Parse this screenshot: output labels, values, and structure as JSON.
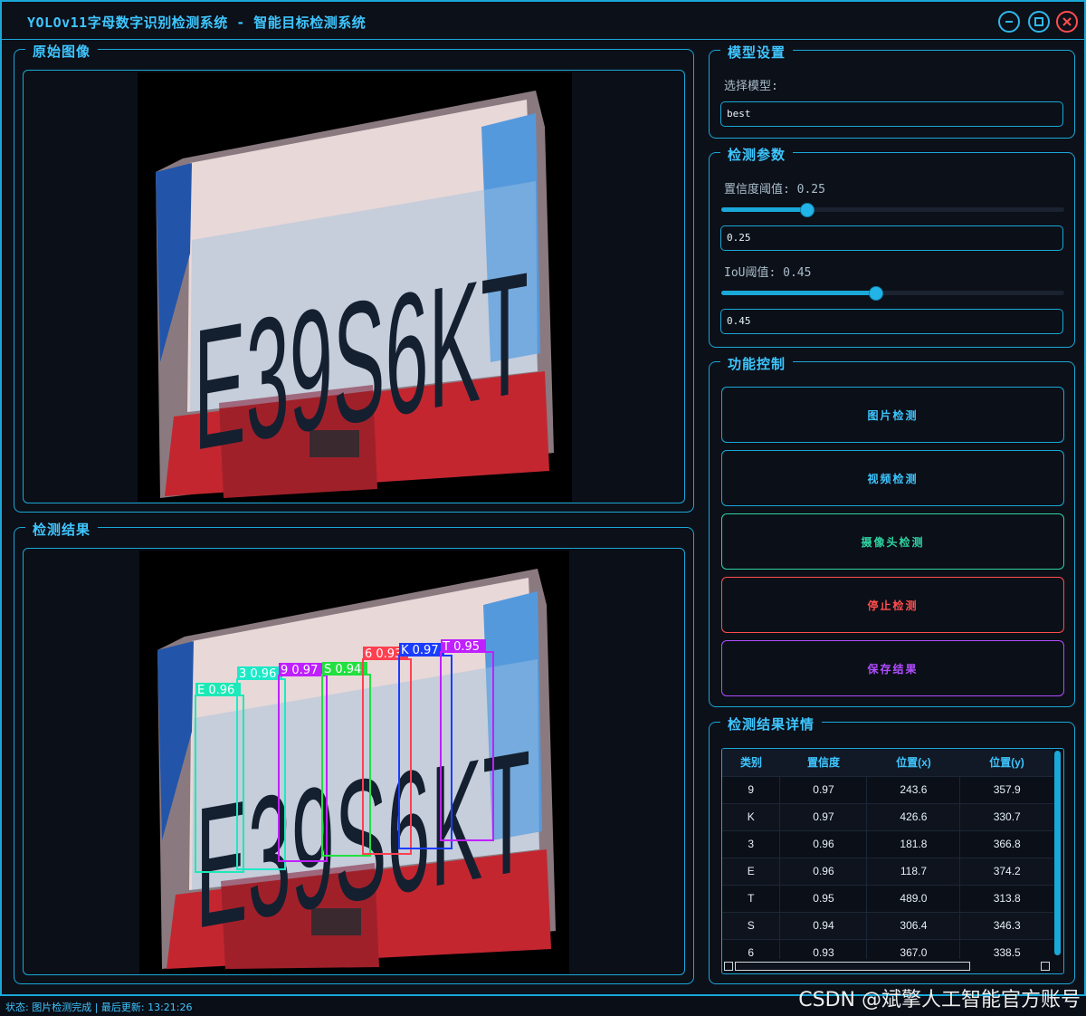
{
  "window": {
    "title": "YOLOv11字母数字识别检测系统 - 智能目标检测系统",
    "min_icon": "minimize-icon",
    "max_icon": "maximize-icon",
    "close_icon": "close-icon"
  },
  "original_panel": {
    "title": "原始图像"
  },
  "result_panel": {
    "title": "检测结果"
  },
  "model_panel": {
    "title": "模型设置",
    "select_label": "选择模型:",
    "selected_model": "best"
  },
  "params_panel": {
    "title": "检测参数",
    "conf_label": "置信度阈值: 0.25",
    "conf_value": "0.25",
    "conf_level": 0.25,
    "iou_label": "IoU阈值: 0.45",
    "iou_value": "0.45",
    "iou_level": 0.45
  },
  "control_panel": {
    "title": "功能控制",
    "image_detect": "图片检测",
    "video_detect": "视频检测",
    "camera_detect": "摄像头检测",
    "stop_detect": "停止检测",
    "save_result": "保存结果"
  },
  "details_panel": {
    "title": "检测结果详情",
    "columns": [
      "类别",
      "置信度",
      "位置(x)",
      "位置(y)"
    ],
    "rows": [
      [
        "9",
        "0.97",
        "243.6",
        "357.9"
      ],
      [
        "K",
        "0.97",
        "426.6",
        "330.7"
      ],
      [
        "3",
        "0.96",
        "181.8",
        "366.8"
      ],
      [
        "E",
        "0.96",
        "118.7",
        "374.2"
      ],
      [
        "T",
        "0.95",
        "489.0",
        "313.8"
      ],
      [
        "S",
        "0.94",
        "306.4",
        "346.3"
      ],
      [
        "6",
        "0.93",
        "367.0",
        "338.5"
      ]
    ]
  },
  "plate_text": "E39S6KT",
  "detections": [
    {
      "label": "E 0.96",
      "color": "#1de9b6"
    },
    {
      "label": "3 0.96",
      "color": "#1de9c8"
    },
    {
      "label": "9 0.97",
      "color": "#c020ff"
    },
    {
      "label": "S 0.94",
      "color": "#22e040"
    },
    {
      "label": "6 0.93",
      "color": "#ff4050"
    },
    {
      "label": "K 0.97",
      "color": "#1a3cff"
    },
    {
      "label": "T 0.95",
      "color": "#c020ff"
    }
  ],
  "statusbar": {
    "text": "状态: 图片检测完成 | 最后更新: 13:21:26"
  },
  "watermark": "CSDN @斌擎人工智能官方账号",
  "colors": {
    "accent": "#1aa8d8",
    "stop": "#ff4d4d",
    "save": "#b04dff",
    "camera": "#2fd3a0"
  }
}
